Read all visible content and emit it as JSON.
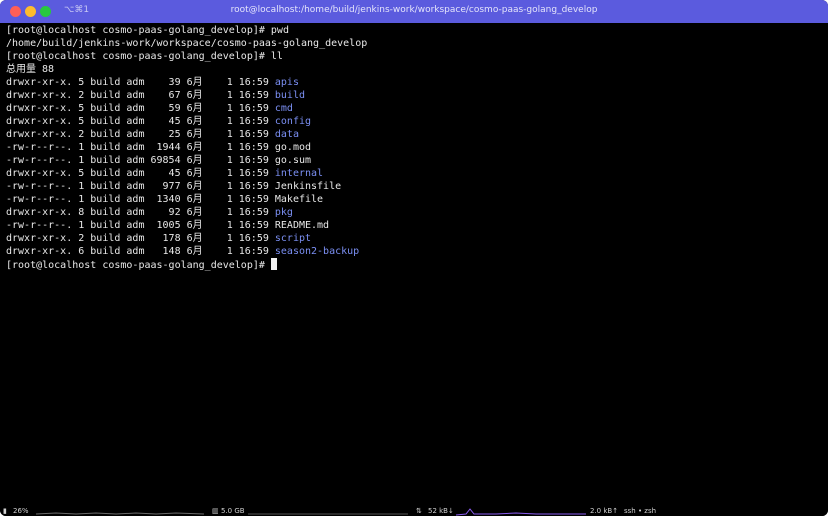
{
  "window": {
    "shortcut": "⌥⌘1",
    "title": "root@localhost:/home/build/jenkins-work/workspace/cosmo-paas-golang_develop"
  },
  "terminal": {
    "lines": [
      {
        "prompt": "[root@localhost cosmo-paas-golang_develop]# ",
        "text": "pwd"
      },
      {
        "text": "/home/build/jenkins-work/workspace/cosmo-paas-golang_develop"
      },
      {
        "prompt": "[root@localhost cosmo-paas-golang_develop]# ",
        "text": "ll"
      },
      {
        "text": "总用量 88"
      },
      {
        "meta": "drwxr-xr-x. 5 build adm    39 6月    1 16:59 ",
        "name": "apis",
        "is_dir": true
      },
      {
        "meta": "drwxr-xr-x. 2 build adm    67 6月    1 16:59 ",
        "name": "build",
        "is_dir": true
      },
      {
        "meta": "drwxr-xr-x. 5 build adm    59 6月    1 16:59 ",
        "name": "cmd",
        "is_dir": true
      },
      {
        "meta": "drwxr-xr-x. 5 build adm    45 6月    1 16:59 ",
        "name": "config",
        "is_dir": true
      },
      {
        "meta": "drwxr-xr-x. 2 build adm    25 6月    1 16:59 ",
        "name": "data",
        "is_dir": true
      },
      {
        "meta": "-rw-r--r--. 1 build adm  1944 6月    1 16:59 ",
        "name": "go.mod",
        "is_dir": false
      },
      {
        "meta": "-rw-r--r--. 1 build adm 69854 6月    1 16:59 ",
        "name": "go.sum",
        "is_dir": false
      },
      {
        "meta": "drwxr-xr-x. 5 build adm    45 6月    1 16:59 ",
        "name": "internal",
        "is_dir": true
      },
      {
        "meta": "-rw-r--r--. 1 build adm   977 6月    1 16:59 ",
        "name": "Jenkinsfile",
        "is_dir": false
      },
      {
        "meta": "-rw-r--r--. 1 build adm  1340 6月    1 16:59 ",
        "name": "Makefile",
        "is_dir": false
      },
      {
        "meta": "drwxr-xr-x. 8 build adm    92 6月    1 16:59 ",
        "name": "pkg",
        "is_dir": true
      },
      {
        "meta": "-rw-r--r--. 1 build adm  1005 6月    1 16:59 ",
        "name": "README.md",
        "is_dir": false
      },
      {
        "meta": "drwxr-xr-x. 2 build adm   178 6月    1 16:59 ",
        "name": "script",
        "is_dir": true
      },
      {
        "meta": "drwxr-xr-x. 6 build adm   148 6月    1 16:59 ",
        "name": "season2-backup",
        "is_dir": true
      },
      {
        "prompt": "[root@localhost cosmo-paas-golang_develop]# ",
        "text": "",
        "cursor": true
      }
    ]
  },
  "statusbar": {
    "cpu": "26%",
    "memory": "5.0 GB",
    "net_down": "52 kB↓",
    "net_up": "2.0 kB↑",
    "session": "ssh • zsh"
  },
  "colors": {
    "titlebar": "#5b5bde",
    "close": "#ff5f57",
    "minimize": "#febc2e",
    "zoom": "#28c840",
    "directory": "#7b8ff3",
    "text": "#e8e8e8"
  }
}
